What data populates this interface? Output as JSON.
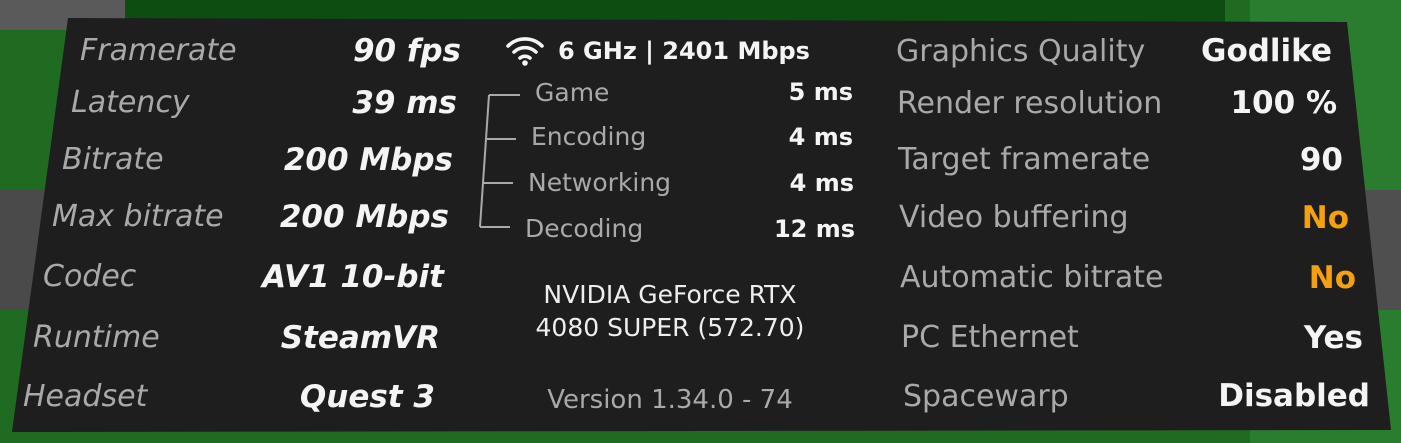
{
  "left_stats": [
    {
      "label": "Framerate",
      "value": "90 fps"
    },
    {
      "label": "Latency",
      "value": "39 ms"
    },
    {
      "label": "Bitrate",
      "value": "200 Mbps"
    },
    {
      "label": "Max bitrate",
      "value": "200 Mbps"
    },
    {
      "label": "Codec",
      "value": "AV1 10-bit"
    },
    {
      "label": "Runtime",
      "value": "SteamVR"
    },
    {
      "label": "Headset",
      "value": "Quest 3"
    }
  ],
  "network": {
    "icon": "wifi-icon",
    "summary": "6 GHz | 2401 Mbps"
  },
  "latency_breakdown": [
    {
      "label": "Game",
      "value": "5 ms"
    },
    {
      "label": "Encoding",
      "value": "4 ms"
    },
    {
      "label": "Networking",
      "value": "4 ms"
    },
    {
      "label": "Decoding",
      "value": "12 ms"
    }
  ],
  "gpu": {
    "line1": "NVIDIA GeForce RTX",
    "line2": "4080 SUPER (572.70)"
  },
  "version": "Version 1.34.0 - 74",
  "right_stats": [
    {
      "label": "Graphics Quality",
      "value": "Godlike",
      "highlight": false
    },
    {
      "label": "Render resolution",
      "value": "100 %",
      "highlight": false
    },
    {
      "label": "Target framerate",
      "value": "90",
      "highlight": false
    },
    {
      "label": "Video buffering",
      "value": "No",
      "highlight": true
    },
    {
      "label": "Automatic bitrate",
      "value": "No",
      "highlight": true
    },
    {
      "label": "PC Ethernet",
      "value": "Yes",
      "highlight": false
    },
    {
      "label": "Spacewarp",
      "value": "Disabled",
      "highlight": false
    }
  ],
  "colors": {
    "panel": "#1e1e1e",
    "label": "#a9a9a9",
    "value": "#f4f4f4",
    "warning": "#f5a00e",
    "background": "#1f6b22"
  }
}
